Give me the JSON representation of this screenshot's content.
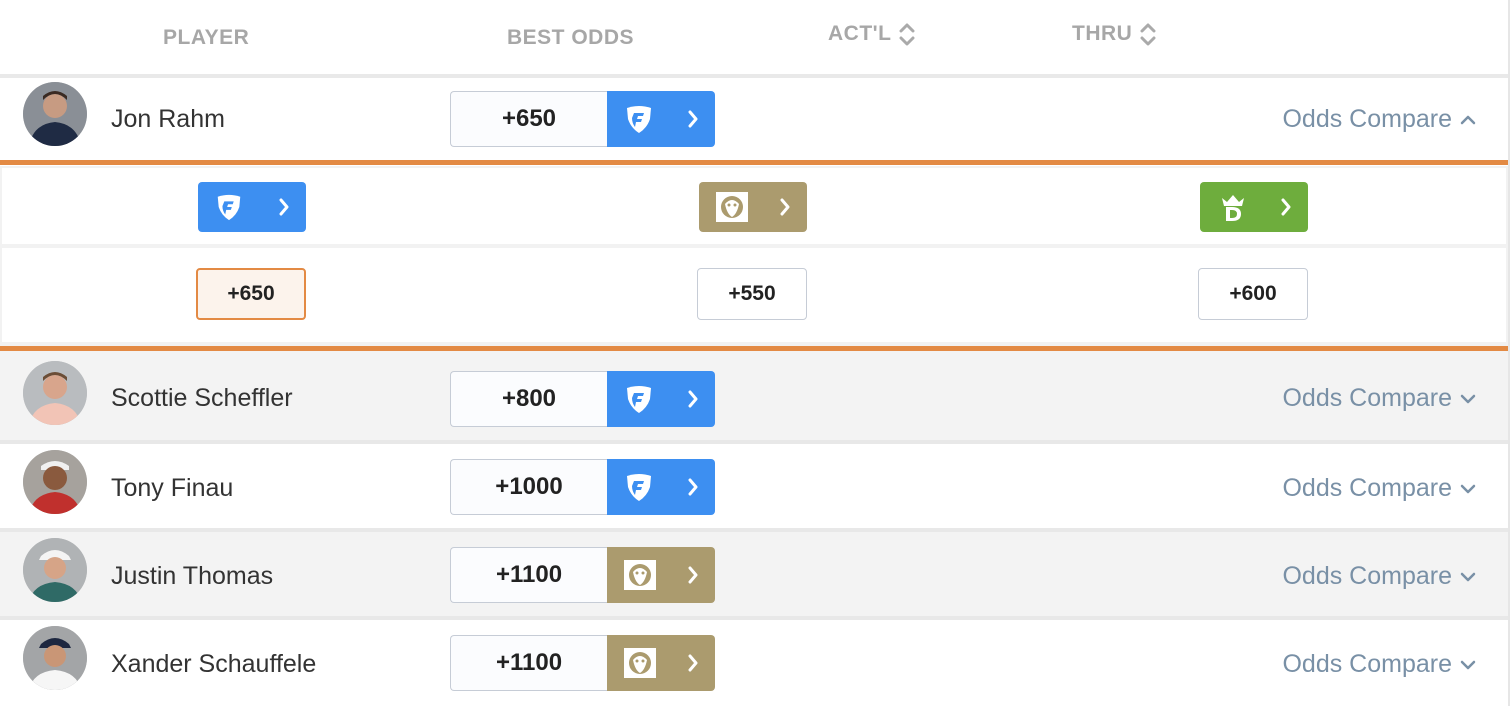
{
  "header": {
    "player": "PLAYER",
    "best_odds": "BEST ODDS",
    "actual": "ACT'L",
    "thru": "THRU"
  },
  "compare_label": "Odds Compare",
  "colors": {
    "fanduel": "#3d8ff1",
    "betmgm": "#ab9b6e",
    "draftkings": "#6ead3d",
    "accent": "#e38a44",
    "link": "#7990a6"
  },
  "players": [
    {
      "name": "Jon Rahm",
      "odds": "+650",
      "book": "fanduel",
      "expanded": true
    },
    {
      "name": "Scottie Scheffler",
      "odds": "+800",
      "book": "fanduel",
      "expanded": false
    },
    {
      "name": "Tony Finau",
      "odds": "+1000",
      "book": "fanduel",
      "expanded": false
    },
    {
      "name": "Justin Thomas",
      "odds": "+1100",
      "book": "betmgm",
      "expanded": false
    },
    {
      "name": "Xander Schauffele",
      "odds": "+1100",
      "book": "betmgm",
      "expanded": false
    }
  ],
  "comparison": {
    "books": [
      {
        "book": "fanduel",
        "icon": "fanduel-shield-icon",
        "odds": "+650",
        "best": true
      },
      {
        "book": "betmgm",
        "icon": "betmgm-lion-icon",
        "odds": "+550",
        "best": false
      },
      {
        "book": "draftkings",
        "icon": "draftkings-crown-icon",
        "odds": "+600",
        "best": false
      }
    ]
  }
}
